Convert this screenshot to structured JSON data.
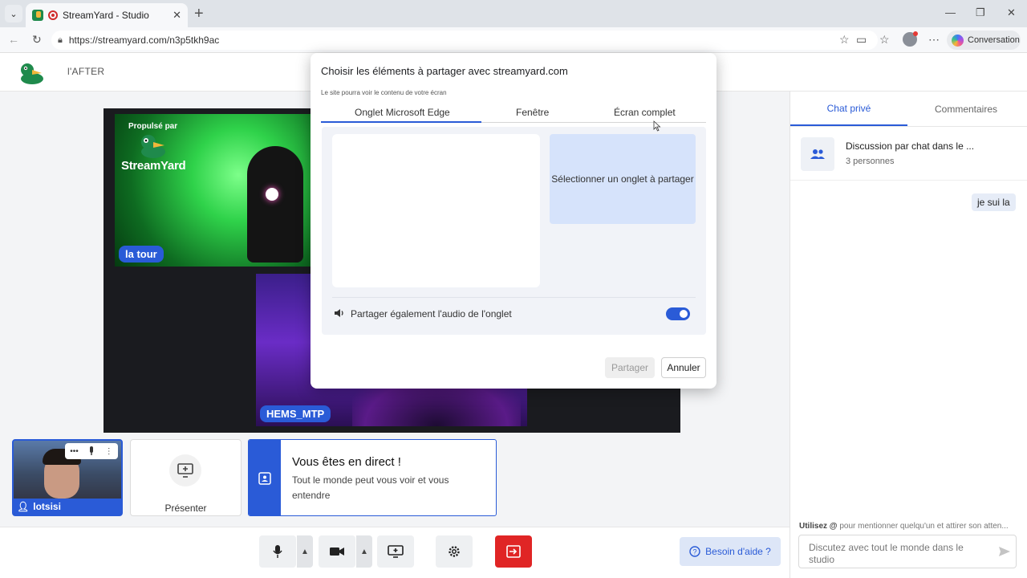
{
  "browser": {
    "tab_title": "StreamYard - Studio",
    "url": "https://streamyard.com/n3p5tkh9ac",
    "conversation_label": "Conversation"
  },
  "app": {
    "show_name": "l'AFTER"
  },
  "stage": {
    "powered_by": "Propulsé par",
    "brand": "StreamYard",
    "guest1_name": "la tour",
    "guest2_name": "HEMS_MTP"
  },
  "tiles": {
    "self_name": "lotsisi",
    "present_label": "Présenter",
    "live_title": "Vous êtes en direct !",
    "live_subtitle": "Tout le monde peut vous voir et vous entendre"
  },
  "bottom_bar": {
    "help_label": "Besoin d'aide ?"
  },
  "side_panel": {
    "tabs": [
      "Chat privé",
      "Commentaires"
    ],
    "active_tab": "Chat privé",
    "discussion_title": "Discussion par chat dans le ...",
    "discussion_sub": "3 personnes",
    "messages": [
      "je sui la"
    ],
    "mention_hint_bold": "Utilisez @",
    "mention_hint_rest": " pour mentionner quelqu'un et attirer son atten...",
    "input_placeholder": "Discutez avec tout le monde dans le studio"
  },
  "share_dialog": {
    "title": "Choisir les éléments à partager avec streamyard.com",
    "description": "Le site pourra voir le contenu de votre écran",
    "tabs": [
      "Onglet Microsoft Edge",
      "Fenêtre",
      "Écran complet"
    ],
    "active_tab": "Onglet Microsoft Edge",
    "select_tab_prompt": "Sélectionner un onglet à partager",
    "audio_label": "Partager également l'audio de l'onglet",
    "audio_enabled": true,
    "share_button": "Partager",
    "cancel_button": "Annuler"
  },
  "colors": {
    "accent": "#2a5bd7",
    "leave": "#e02525",
    "toggle_on": "#2a5bd7"
  }
}
